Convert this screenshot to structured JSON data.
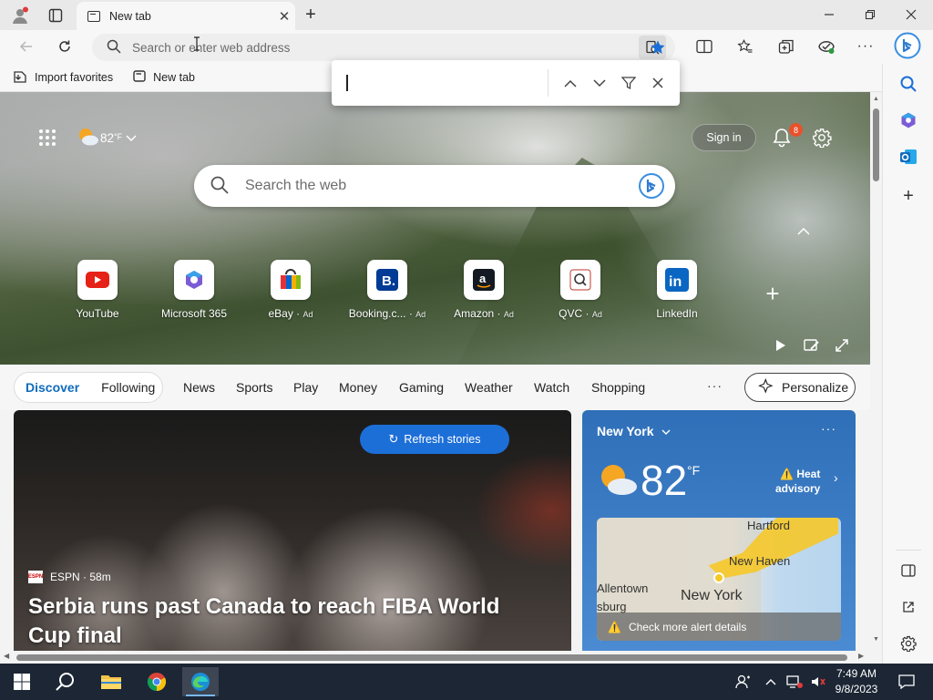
{
  "window": {
    "tab_title": "New tab"
  },
  "address_bar": {
    "placeholder": "Search or enter web address"
  },
  "favorites_bar": {
    "items": [
      {
        "label": "Import favorites"
      },
      {
        "label": "New tab"
      }
    ]
  },
  "hero": {
    "weather_temp": "82",
    "weather_unit": "°F",
    "signin_label": "Sign in",
    "notification_count": "8",
    "search_placeholder": "Search the web"
  },
  "quick_links": [
    {
      "label": "YouTube",
      "ad": "",
      "icon": "youtube-icon"
    },
    {
      "label": "Microsoft 365",
      "ad": "",
      "icon": "microsoft-365-icon"
    },
    {
      "label": "eBay",
      "ad": "Ad",
      "icon": "ebay-icon"
    },
    {
      "label": "Booking.c...",
      "ad": "Ad",
      "icon": "booking-icon"
    },
    {
      "label": "Amazon",
      "ad": "Ad",
      "icon": "amazon-icon"
    },
    {
      "label": "QVC",
      "ad": "Ad",
      "icon": "qvc-icon"
    },
    {
      "label": "LinkedIn",
      "ad": "",
      "icon": "linkedin-icon"
    }
  ],
  "feed_nav": {
    "discover": "Discover",
    "following": "Following",
    "links": [
      "News",
      "Sports",
      "Play",
      "Money",
      "Gaming",
      "Weather",
      "Watch",
      "Shopping"
    ],
    "more": "···",
    "personalize": "Personalize"
  },
  "story": {
    "refresh_label": "Refresh stories",
    "source": "ESPN · 58m",
    "source_logo": "ESPN",
    "headline": "Serbia runs past Canada to reach FIBA World Cup final"
  },
  "weather_card": {
    "city": "New York",
    "temp": "82",
    "unit": "°F",
    "more": "···",
    "alert_line1": "Heat",
    "alert_line2": "advisory",
    "map_labels": [
      "Hartford",
      "New Haven",
      "Allentown",
      "New York",
      "sburg"
    ],
    "alert_details": "Check more alert details"
  },
  "taskbar": {
    "time": "7:49 AM",
    "date": "9/8/2023"
  },
  "colors": {
    "accent": "#0f6cbd",
    "refresh": "#1d6fd8",
    "weather_card": "#2f6fb8",
    "badge": "#e8512a",
    "taskbar": "#1c2634"
  }
}
